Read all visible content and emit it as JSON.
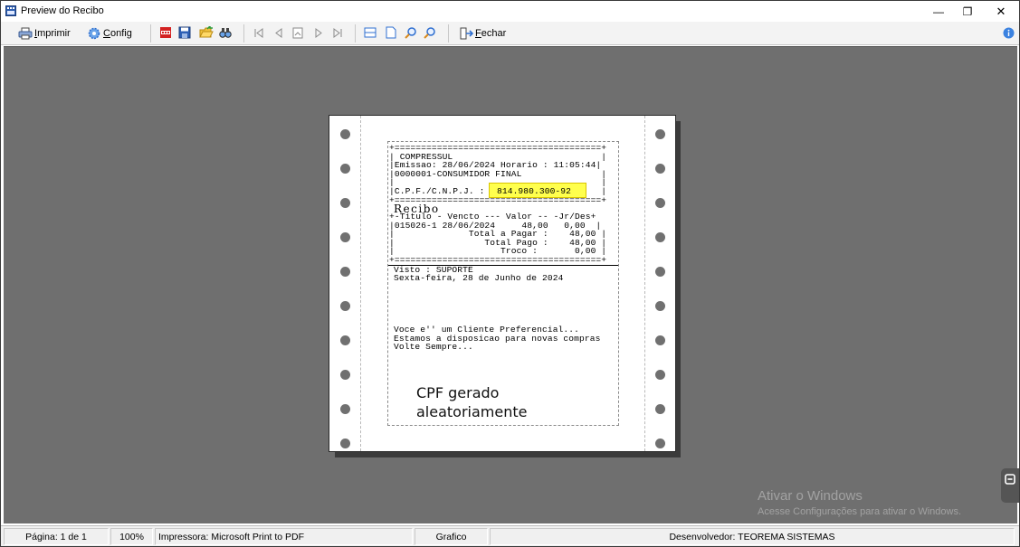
{
  "window": {
    "title": "Preview do Recibo",
    "minimize_glyph": "—",
    "restore_glyph": "❐",
    "close_glyph": "✕"
  },
  "toolbar": {
    "print_label_u": "I",
    "print_label_rest": "mprimir",
    "config_label_u": "C",
    "config_label_rest": "onfig",
    "close_label_u": "F",
    "close_label_rest": "echar"
  },
  "receipt": {
    "lines_top": "+=======================================+\n| COMPRESSUL                            |\n|Emissao: 28/06/2024 Horario : 11:05:44|\n|0000001-CONSUMIDOR FINAL               |\n|                                       |\n|C.P.F./C.N.P.J. :                      |\n+=======================================+",
    "cpf_value": "814.980.300-92",
    "title": "Recibo",
    "lines_items": "+-Titulo - Vencto --- Valor -- -Jr/Des+\n|015026-1 28/06/2024     48,00   0,00  |\n|              Total a Pagar :    48,00 |\n|                 Total Pago :    48,00 |\n|                    Troco :       0,00 |\n+=======================================+",
    "visto": "Visto : SUPORTE",
    "date_line": "Sexta-feira, 28 de Junho de 2024",
    "footer_lines": "Voce e'' um Cliente Preferencial...\nEstamos a disposicao para novas compras\nVolte Sempre..."
  },
  "annotation": {
    "line1": "CPF gerado",
    "line2": "aleatoriamente"
  },
  "watermark": {
    "line1": "Ativar o Windows",
    "line2": "Acesse Configurações para ativar o Windows."
  },
  "status": {
    "page": "Página: 1 de 1",
    "zoom": "100%",
    "printer": "Impressora: Microsoft Print to PDF",
    "mode": "Grafico",
    "developer": "Desenvolvedor: TEOREMA SISTEMAS"
  },
  "colors": {
    "workarea": "#6f6f6f",
    "highlight": "#ffff4d",
    "accent_blue": "#2f6fd0"
  },
  "icons": [
    "receipt-app-icon",
    "printer-icon",
    "gear-icon",
    "pdf-icon",
    "save-icon",
    "open-folder-icon",
    "find-icon",
    "first-page-icon",
    "prev-page-icon",
    "goto-page-icon",
    "next-page-icon",
    "last-page-icon",
    "page-width-icon",
    "whole-page-icon",
    "zoom-in-icon",
    "zoom-out-icon",
    "exit-icon",
    "info-icon"
  ]
}
